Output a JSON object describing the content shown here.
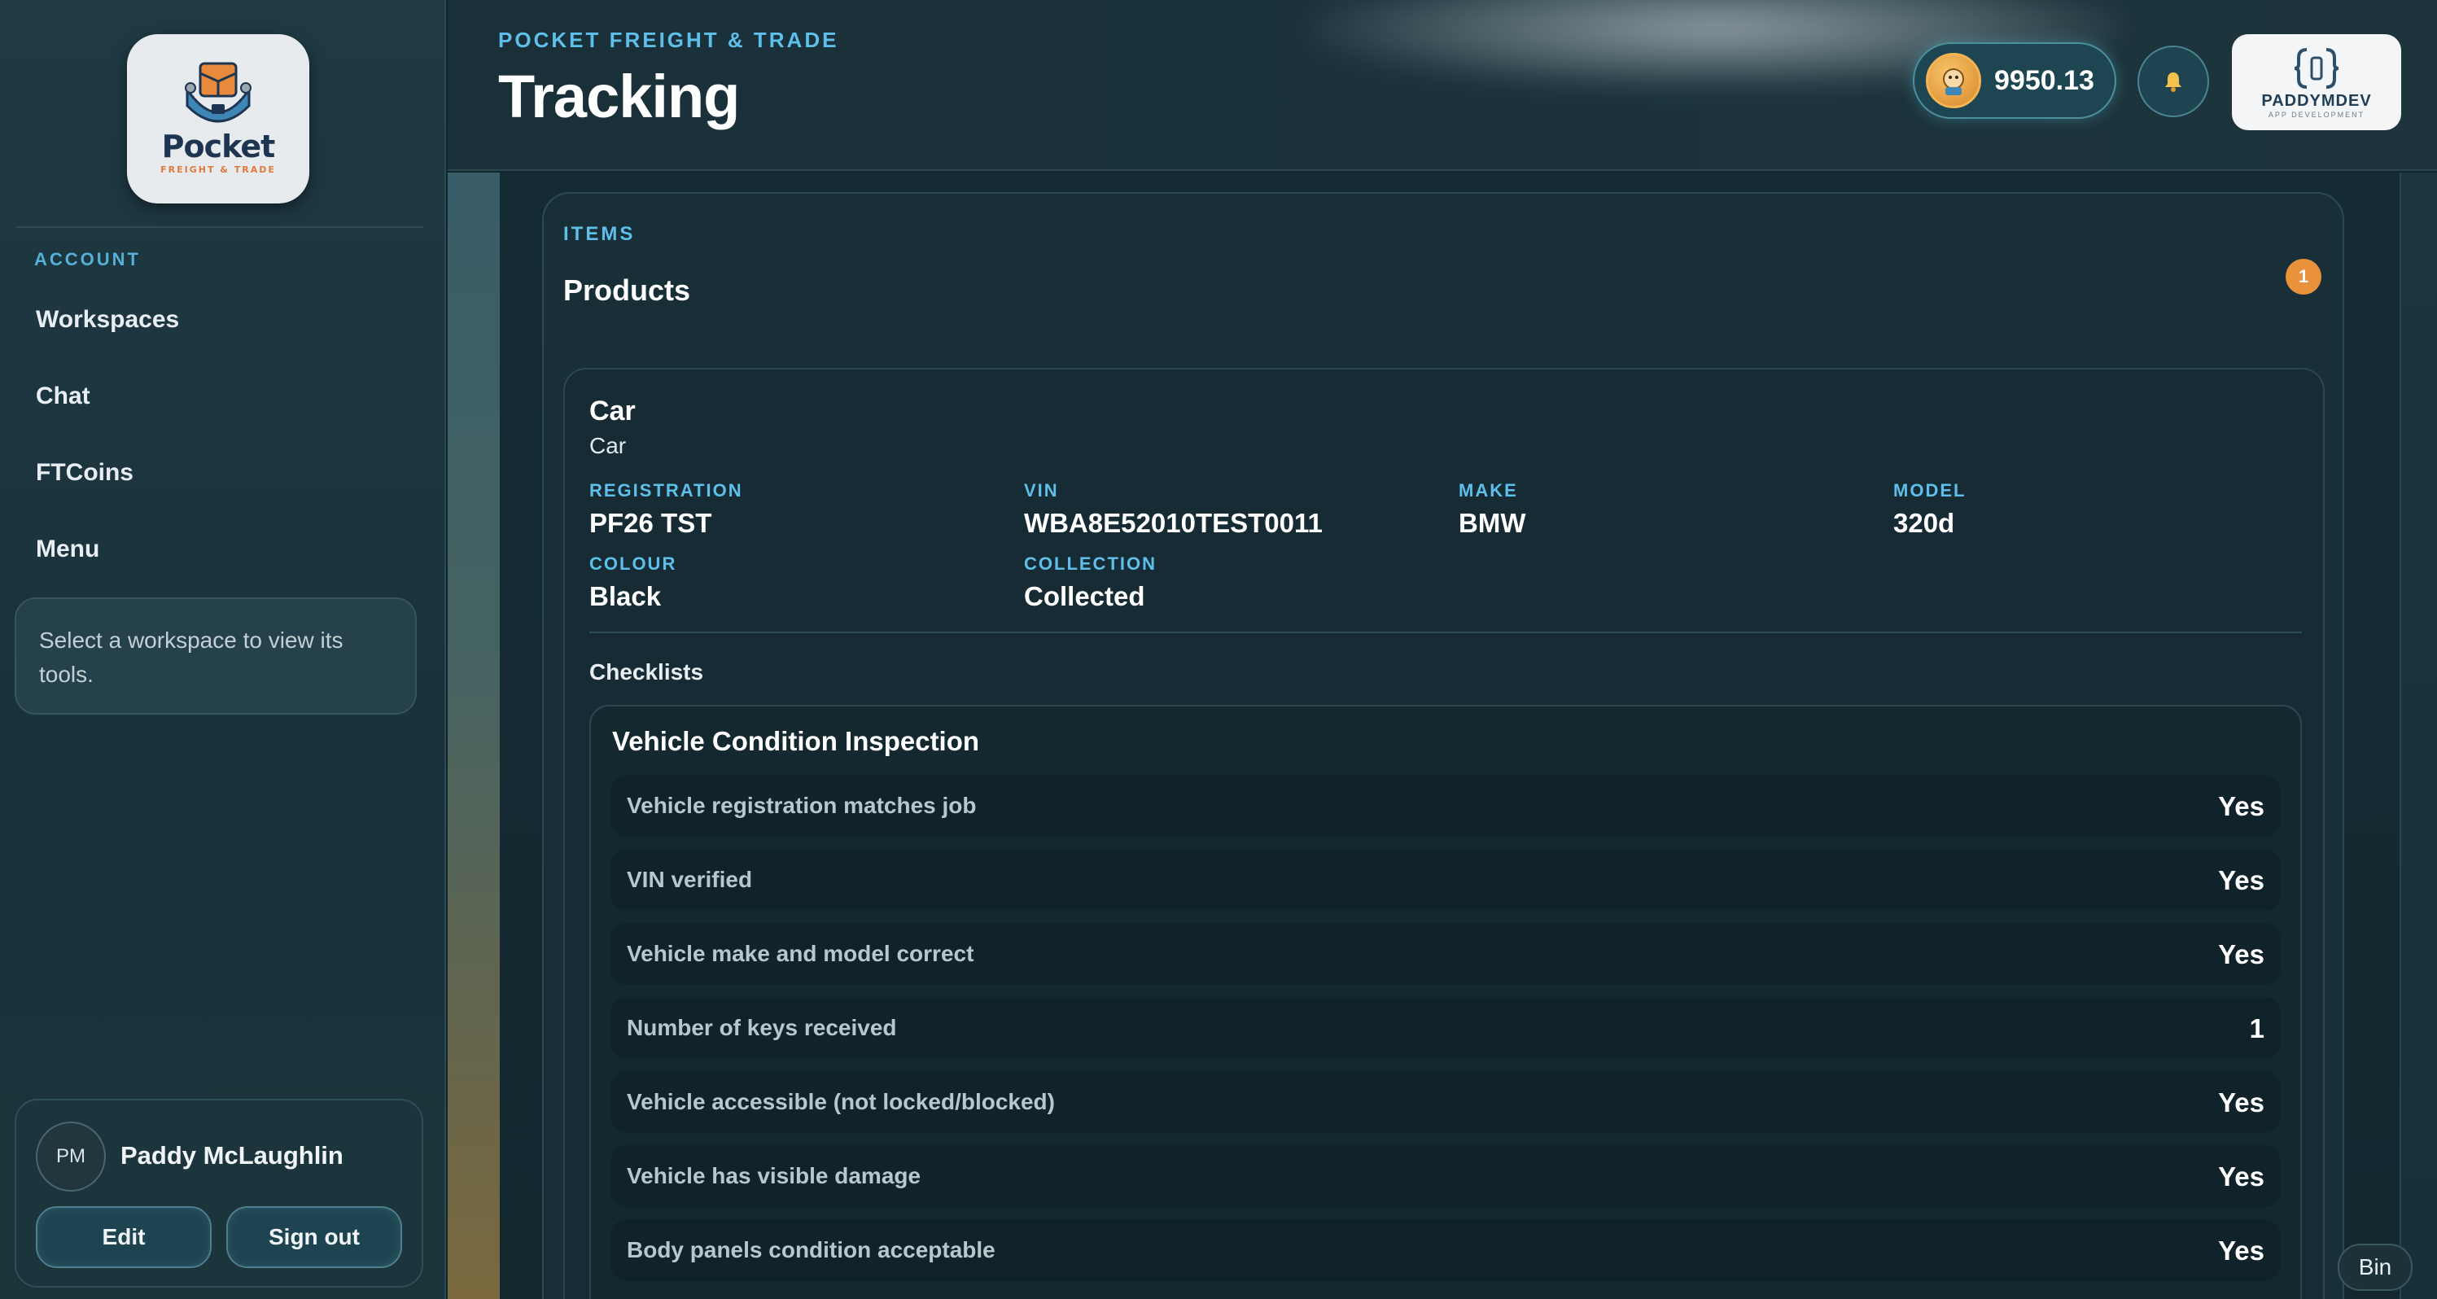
{
  "sidebar": {
    "logo": {
      "word": "Pocket",
      "sub": "FREIGHT & TRADE"
    },
    "section_label": "ACCOUNT",
    "nav": [
      "Workspaces",
      "Chat",
      "FTCoins",
      "Menu"
    ],
    "hint": "Select a workspace to view its tools.",
    "user": {
      "initials": "PM",
      "name": "Paddy McLaughlin",
      "edit_label": "Edit",
      "signout_label": "Sign out"
    }
  },
  "header": {
    "eyebrow": "POCKET FREIGHT & TRADE",
    "title": "Tracking",
    "coins": "9950.13",
    "dev_logo": {
      "name": "PADDYMDEV",
      "sub": "APP DEVELOPMENT"
    }
  },
  "panel": {
    "eyebrow": "ITEMS",
    "title": "Products",
    "count": "1"
  },
  "item": {
    "name": "Car",
    "type": "Car",
    "fields": [
      {
        "label": "REGISTRATION",
        "value": "PF26 TST"
      },
      {
        "label": "VIN",
        "value": "WBA8E52010TEST0011"
      },
      {
        "label": "MAKE",
        "value": "BMW"
      },
      {
        "label": "MODEL",
        "value": "320d"
      },
      {
        "label": "COLOUR",
        "value": "Black"
      },
      {
        "label": "COLLECTION",
        "value": "Collected"
      }
    ],
    "checklists_heading": "Checklists",
    "checklist": {
      "title": "Vehicle Condition Inspection",
      "rows": [
        {
          "label": "Vehicle registration matches job",
          "value": "Yes"
        },
        {
          "label": "VIN verified",
          "value": "Yes"
        },
        {
          "label": "Vehicle make and model correct",
          "value": "Yes"
        },
        {
          "label": "Number of keys received",
          "value": "1"
        },
        {
          "label": "Vehicle accessible (not locked/blocked)",
          "value": "Yes"
        },
        {
          "label": "Vehicle has visible damage",
          "value": "Yes"
        },
        {
          "label": "Body panels condition acceptable",
          "value": "Yes"
        }
      ]
    }
  },
  "bin_label": "Bin",
  "colors": {
    "accent": "#5ec0ea",
    "badge": "#e9923b",
    "background": "#13262e"
  }
}
